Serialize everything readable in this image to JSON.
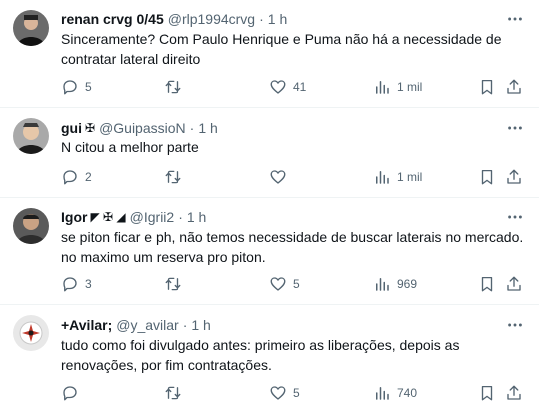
{
  "tweets": [
    {
      "name": "renan crvg 0/45",
      "badges": "",
      "handle": "@rlp1994crvg",
      "sep": "·",
      "time": "1 h",
      "lines": [
        "Sinceramente? Com Paulo Henrique e Puma não há a necessidade de",
        "contratar lateral direito"
      ],
      "replies": "5",
      "retweets": "",
      "likes": "41",
      "views": "1 mil",
      "avatar_bg": "#6b6b6b"
    },
    {
      "name": "gui",
      "badges": "✠",
      "handle": "@GuipassioN",
      "sep": "·",
      "time": "1 h",
      "lines": [
        "N citou a melhor parte"
      ],
      "replies": "2",
      "retweets": "",
      "likes": "",
      "views": "1 mil",
      "avatar_bg": "#a9a9a9"
    },
    {
      "name": "Igor",
      "badges": "◤ ✠ ◢",
      "handle": "@Igrii2",
      "sep": "·",
      "time": "1 h",
      "lines": [
        "se piton ficar e ph, não temos necessidade de buscar laterais no mercado.",
        "no maximo um reserva pro piton."
      ],
      "replies": "3",
      "retweets": "",
      "likes": "5",
      "views": "969",
      "avatar_bg": "#5a5a5a"
    },
    {
      "name": "+Avilar;",
      "badges": "",
      "handle": "@y_avilar",
      "sep": "·",
      "time": "1 h",
      "lines": [
        "tudo como foi divulgado antes: primeiro as liberações, depois as",
        "renovações, por fim contratações."
      ],
      "replies": "",
      "retweets": "",
      "likes": "5",
      "views": "740",
      "avatar_bg": "#e8e8e8"
    }
  ],
  "icons": {
    "more": "more-horizontal-icon",
    "reply": "reply-icon",
    "retweet": "retweet-icon",
    "like": "heart-icon",
    "views": "views-icon",
    "bookmark": "bookmark-icon",
    "share": "share-icon"
  },
  "colors": {
    "text": "#0f1419",
    "secondary": "#536471",
    "divider": "#eff3f4"
  }
}
